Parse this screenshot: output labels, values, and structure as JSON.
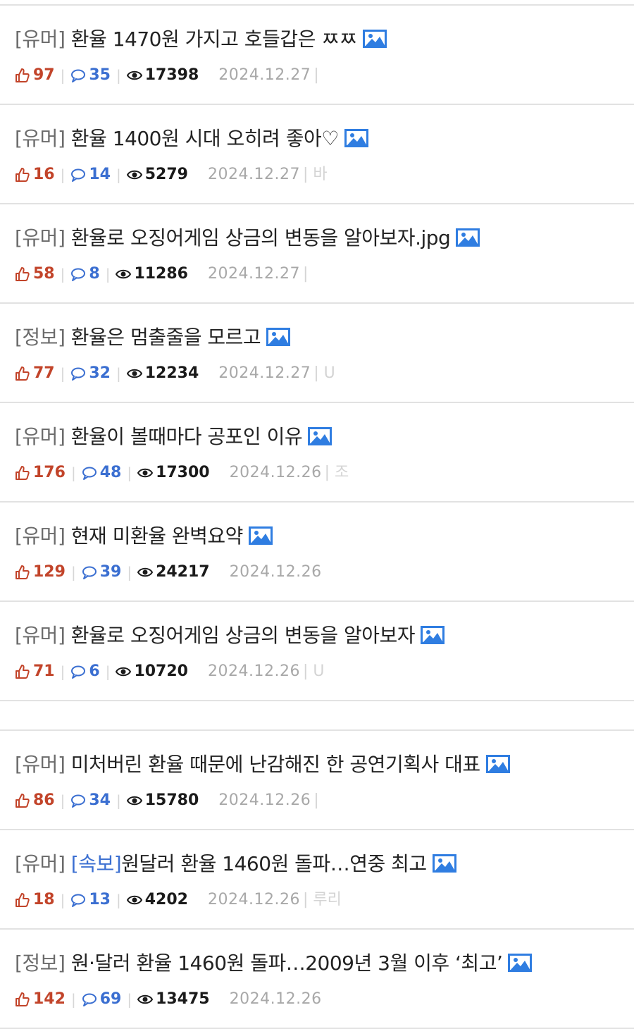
{
  "posts": [
    {
      "category": "[유머]",
      "tag": "",
      "title": "환율 1470원 가지고 호들갑은 ㅉㅉ",
      "likes": "97",
      "comments": "35",
      "views": "17398",
      "date": "2024.12.27",
      "suffix": "|"
    },
    {
      "category": "[유머]",
      "tag": "",
      "title": "환율 1400원 시대 오히려 좋아♡",
      "likes": "16",
      "comments": "14",
      "views": "5279",
      "date": "2024.12.27",
      "suffix": "| 바"
    },
    {
      "category": "[유머]",
      "tag": "",
      "title": "환율로 오징어게임 상금의 변동을 알아보자.jpg",
      "likes": "58",
      "comments": "8",
      "views": "11286",
      "date": "2024.12.27",
      "suffix": "|"
    },
    {
      "category": "[정보]",
      "tag": "",
      "title": "환율은 멈출줄을 모르고",
      "likes": "77",
      "comments": "32",
      "views": "12234",
      "date": "2024.12.27",
      "suffix": "| U"
    },
    {
      "category": "[유머]",
      "tag": "",
      "title": "환율이 볼때마다 공포인 이유",
      "likes": "176",
      "comments": "48",
      "views": "17300",
      "date": "2024.12.26",
      "suffix": "| 조"
    },
    {
      "category": "[유머]",
      "tag": "",
      "title": "현재 미환율 완벽요약",
      "likes": "129",
      "comments": "39",
      "views": "24217",
      "date": "2024.12.26",
      "suffix": ""
    },
    {
      "category": "[유머]",
      "tag": "",
      "title": "환율로 오징어게임 상금의 변동을 알아보자",
      "likes": "71",
      "comments": "6",
      "views": "10720",
      "date": "2024.12.26",
      "suffix": "| U"
    },
    {
      "category": "[유머]",
      "tag": "",
      "title": "미처버린 환율 때문에 난감해진 한 공연기획사 대표",
      "likes": "86",
      "comments": "34",
      "views": "15780",
      "date": "2024.12.26",
      "suffix": "|"
    },
    {
      "category": "[유머]",
      "tag": "[속보]",
      "title": "원달러 환율 1460원 돌파…연중 최고",
      "likes": "18",
      "comments": "13",
      "views": "4202",
      "date": "2024.12.26",
      "suffix": "| 루리"
    },
    {
      "category": "[정보]",
      "tag": "",
      "title": "원·달러 환율 1460원 돌파…2009년 3월 이후 ‘최고’",
      "likes": "142",
      "comments": "69",
      "views": "13475",
      "date": "2024.12.26",
      "suffix": ""
    }
  ],
  "colors": {
    "likes": "#c2442a",
    "comments": "#3b6fd1",
    "views": "#1a1a1a",
    "date": "#a8a8a8",
    "category": "#6b6b6b",
    "image_icon": "#2f7de1"
  },
  "icons": {
    "likes": "thumbs-up-icon",
    "comments": "speech-bubble-icon",
    "views": "eye-icon",
    "attachment": "image-icon"
  }
}
